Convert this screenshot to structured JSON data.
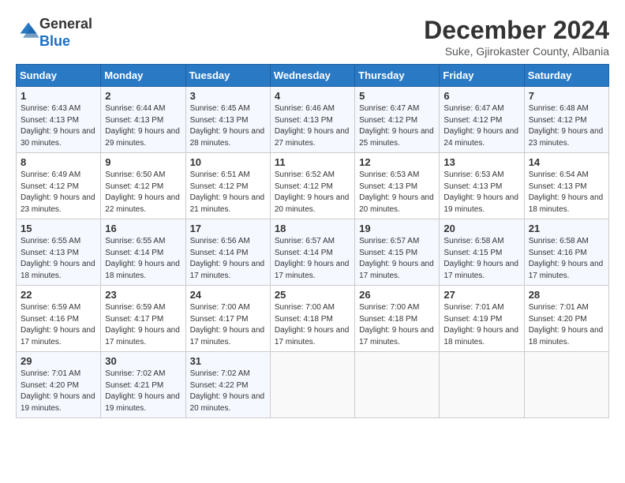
{
  "logo": {
    "line1": "General",
    "line2": "Blue"
  },
  "title": "December 2024",
  "subtitle": "Suke, Gjirokaster County, Albania",
  "days_of_week": [
    "Sunday",
    "Monday",
    "Tuesday",
    "Wednesday",
    "Thursday",
    "Friday",
    "Saturday"
  ],
  "weeks": [
    [
      {
        "day": "1",
        "sunrise": "6:43 AM",
        "sunset": "4:13 PM",
        "daylight": "9 hours and 30 minutes."
      },
      {
        "day": "2",
        "sunrise": "6:44 AM",
        "sunset": "4:13 PM",
        "daylight": "9 hours and 29 minutes."
      },
      {
        "day": "3",
        "sunrise": "6:45 AM",
        "sunset": "4:13 PM",
        "daylight": "9 hours and 28 minutes."
      },
      {
        "day": "4",
        "sunrise": "6:46 AM",
        "sunset": "4:13 PM",
        "daylight": "9 hours and 27 minutes."
      },
      {
        "day": "5",
        "sunrise": "6:47 AM",
        "sunset": "4:12 PM",
        "daylight": "9 hours and 25 minutes."
      },
      {
        "day": "6",
        "sunrise": "6:47 AM",
        "sunset": "4:12 PM",
        "daylight": "9 hours and 24 minutes."
      },
      {
        "day": "7",
        "sunrise": "6:48 AM",
        "sunset": "4:12 PM",
        "daylight": "9 hours and 23 minutes."
      }
    ],
    [
      {
        "day": "8",
        "sunrise": "6:49 AM",
        "sunset": "4:12 PM",
        "daylight": "9 hours and 23 minutes."
      },
      {
        "day": "9",
        "sunrise": "6:50 AM",
        "sunset": "4:12 PM",
        "daylight": "9 hours and 22 minutes."
      },
      {
        "day": "10",
        "sunrise": "6:51 AM",
        "sunset": "4:12 PM",
        "daylight": "9 hours and 21 minutes."
      },
      {
        "day": "11",
        "sunrise": "6:52 AM",
        "sunset": "4:12 PM",
        "daylight": "9 hours and 20 minutes."
      },
      {
        "day": "12",
        "sunrise": "6:53 AM",
        "sunset": "4:13 PM",
        "daylight": "9 hours and 20 minutes."
      },
      {
        "day": "13",
        "sunrise": "6:53 AM",
        "sunset": "4:13 PM",
        "daylight": "9 hours and 19 minutes."
      },
      {
        "day": "14",
        "sunrise": "6:54 AM",
        "sunset": "4:13 PM",
        "daylight": "9 hours and 18 minutes."
      }
    ],
    [
      {
        "day": "15",
        "sunrise": "6:55 AM",
        "sunset": "4:13 PM",
        "daylight": "9 hours and 18 minutes."
      },
      {
        "day": "16",
        "sunrise": "6:55 AM",
        "sunset": "4:14 PM",
        "daylight": "9 hours and 18 minutes."
      },
      {
        "day": "17",
        "sunrise": "6:56 AM",
        "sunset": "4:14 PM",
        "daylight": "9 hours and 17 minutes."
      },
      {
        "day": "18",
        "sunrise": "6:57 AM",
        "sunset": "4:14 PM",
        "daylight": "9 hours and 17 minutes."
      },
      {
        "day": "19",
        "sunrise": "6:57 AM",
        "sunset": "4:15 PM",
        "daylight": "9 hours and 17 minutes."
      },
      {
        "day": "20",
        "sunrise": "6:58 AM",
        "sunset": "4:15 PM",
        "daylight": "9 hours and 17 minutes."
      },
      {
        "day": "21",
        "sunrise": "6:58 AM",
        "sunset": "4:16 PM",
        "daylight": "9 hours and 17 minutes."
      }
    ],
    [
      {
        "day": "22",
        "sunrise": "6:59 AM",
        "sunset": "4:16 PM",
        "daylight": "9 hours and 17 minutes."
      },
      {
        "day": "23",
        "sunrise": "6:59 AM",
        "sunset": "4:17 PM",
        "daylight": "9 hours and 17 minutes."
      },
      {
        "day": "24",
        "sunrise": "7:00 AM",
        "sunset": "4:17 PM",
        "daylight": "9 hours and 17 minutes."
      },
      {
        "day": "25",
        "sunrise": "7:00 AM",
        "sunset": "4:18 PM",
        "daylight": "9 hours and 17 minutes."
      },
      {
        "day": "26",
        "sunrise": "7:00 AM",
        "sunset": "4:18 PM",
        "daylight": "9 hours and 17 minutes."
      },
      {
        "day": "27",
        "sunrise": "7:01 AM",
        "sunset": "4:19 PM",
        "daylight": "9 hours and 18 minutes."
      },
      {
        "day": "28",
        "sunrise": "7:01 AM",
        "sunset": "4:20 PM",
        "daylight": "9 hours and 18 minutes."
      }
    ],
    [
      {
        "day": "29",
        "sunrise": "7:01 AM",
        "sunset": "4:20 PM",
        "daylight": "9 hours and 19 minutes."
      },
      {
        "day": "30",
        "sunrise": "7:02 AM",
        "sunset": "4:21 PM",
        "daylight": "9 hours and 19 minutes."
      },
      {
        "day": "31",
        "sunrise": "7:02 AM",
        "sunset": "4:22 PM",
        "daylight": "9 hours and 20 minutes."
      },
      null,
      null,
      null,
      null
    ]
  ]
}
